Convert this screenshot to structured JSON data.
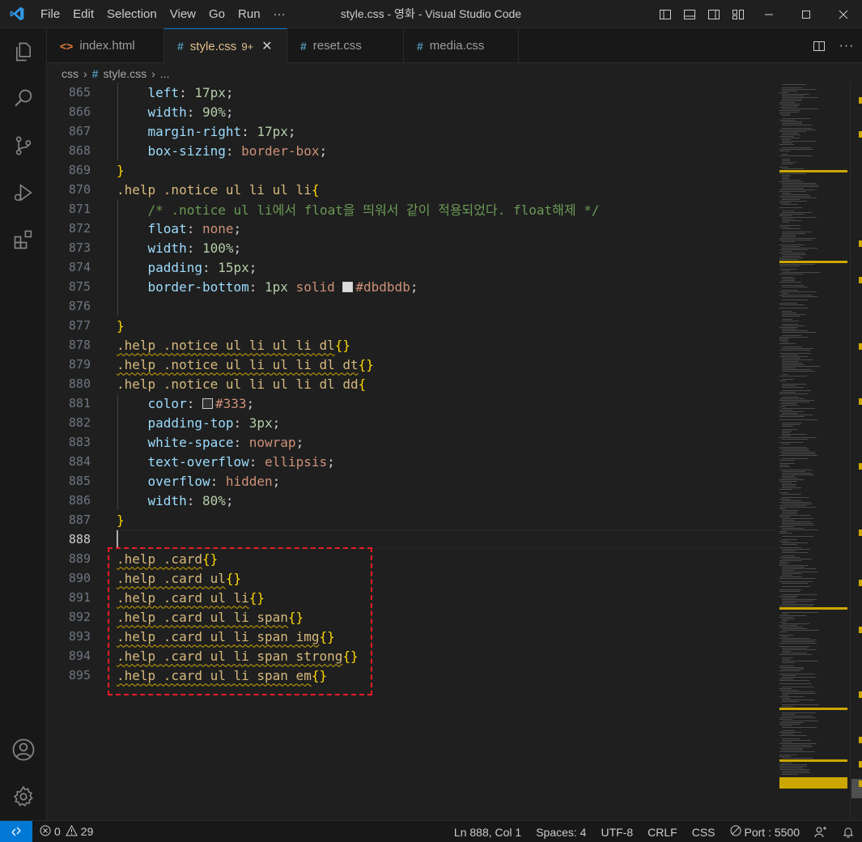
{
  "titlebar": {
    "menu": [
      "File",
      "Edit",
      "Selection",
      "View",
      "Go",
      "Run",
      "···"
    ],
    "title": "style.css - 영화 - Visual Studio Code"
  },
  "tabs": [
    {
      "icon": "<>",
      "label": "index.html",
      "active": false,
      "badge": "",
      "icon_color": "#e37933"
    },
    {
      "icon": "#",
      "label": "style.css",
      "active": true,
      "badge": "9+",
      "icon_color": "#519aba"
    },
    {
      "icon": "#",
      "label": "reset.css",
      "active": false,
      "badge": "",
      "icon_color": "#519aba"
    },
    {
      "icon": "#",
      "label": "media.css",
      "active": false,
      "badge": "",
      "icon_color": "#519aba"
    }
  ],
  "breadcrumb": {
    "folder": "css",
    "file": "style.css",
    "more": "..."
  },
  "editor": {
    "current_line": 888,
    "lines": [
      {
        "n": 865,
        "tokens": [
          [
            "    ",
            "pun"
          ],
          [
            "left",
            "prop"
          ],
          [
            ": ",
            "pun"
          ],
          [
            "17px",
            "num"
          ],
          [
            ";",
            "pun"
          ]
        ]
      },
      {
        "n": 866,
        "tokens": [
          [
            "    ",
            "pun"
          ],
          [
            "width",
            "prop"
          ],
          [
            ": ",
            "pun"
          ],
          [
            "90%",
            "num"
          ],
          [
            ";",
            "pun"
          ]
        ]
      },
      {
        "n": 867,
        "tokens": [
          [
            "    ",
            "pun"
          ],
          [
            "margin-right",
            "prop"
          ],
          [
            ": ",
            "pun"
          ],
          [
            "17px",
            "num"
          ],
          [
            ";",
            "pun"
          ]
        ]
      },
      {
        "n": 868,
        "tokens": [
          [
            "    ",
            "pun"
          ],
          [
            "box-sizing",
            "prop"
          ],
          [
            ": ",
            "pun"
          ],
          [
            "border-box",
            "val"
          ],
          [
            ";",
            "pun"
          ]
        ]
      },
      {
        "n": 869,
        "tokens": [
          [
            "}",
            "br"
          ]
        ]
      },
      {
        "n": 870,
        "tokens": [
          [
            ".help .notice ul li ul li",
            "sel"
          ],
          [
            "{",
            "br"
          ]
        ]
      },
      {
        "n": 871,
        "tokens": [
          [
            "    ",
            "pun"
          ],
          [
            "/* .notice ul li에서 float을 띄워서 같이 적용되었다. float해제 */",
            "com"
          ]
        ]
      },
      {
        "n": 872,
        "tokens": [
          [
            "    ",
            "pun"
          ],
          [
            "float",
            "prop"
          ],
          [
            ": ",
            "pun"
          ],
          [
            "none",
            "val"
          ],
          [
            ";",
            "pun"
          ]
        ]
      },
      {
        "n": 873,
        "tokens": [
          [
            "    ",
            "pun"
          ],
          [
            "width",
            "prop"
          ],
          [
            ": ",
            "pun"
          ],
          [
            "100%",
            "num"
          ],
          [
            ";",
            "pun"
          ]
        ]
      },
      {
        "n": 874,
        "tokens": [
          [
            "    ",
            "pun"
          ],
          [
            "padding",
            "prop"
          ],
          [
            ": ",
            "pun"
          ],
          [
            "15px",
            "num"
          ],
          [
            ";",
            "pun"
          ]
        ]
      },
      {
        "n": 875,
        "tokens": [
          [
            "    ",
            "pun"
          ],
          [
            "border-bottom",
            "prop"
          ],
          [
            ": ",
            "pun"
          ],
          [
            "1px",
            "num"
          ],
          [
            " ",
            "pun"
          ],
          [
            "solid",
            "val"
          ],
          [
            " ",
            "pun"
          ],
          [
            "#dbdbdb",
            "swatch"
          ],
          [
            "#dbdbdb",
            "val"
          ],
          [
            ";",
            "pun"
          ]
        ]
      },
      {
        "n": 876,
        "tokens": []
      },
      {
        "n": 877,
        "tokens": [
          [
            "}",
            "br"
          ]
        ]
      },
      {
        "n": 878,
        "tokens": [
          [
            ".help .notice ul li ul li dl",
            "sel sq"
          ],
          [
            "{}",
            "br"
          ]
        ]
      },
      {
        "n": 879,
        "tokens": [
          [
            ".help .notice ul li ul li dl dt",
            "sel sq"
          ],
          [
            "{}",
            "br"
          ]
        ]
      },
      {
        "n": 880,
        "tokens": [
          [
            ".help .notice ul li ul li dl dd",
            "sel"
          ],
          [
            "{",
            "br"
          ]
        ]
      },
      {
        "n": 881,
        "tokens": [
          [
            "    ",
            "pun"
          ],
          [
            "color",
            "prop"
          ],
          [
            ": ",
            "pun"
          ],
          [
            "#333",
            "swatch"
          ],
          [
            "#333",
            "val"
          ],
          [
            ";",
            "pun"
          ]
        ]
      },
      {
        "n": 882,
        "tokens": [
          [
            "    ",
            "pun"
          ],
          [
            "padding-top",
            "prop"
          ],
          [
            ": ",
            "pun"
          ],
          [
            "3px",
            "num"
          ],
          [
            ";",
            "pun"
          ]
        ]
      },
      {
        "n": 883,
        "tokens": [
          [
            "    ",
            "pun"
          ],
          [
            "white-space",
            "prop"
          ],
          [
            ": ",
            "pun"
          ],
          [
            "nowrap",
            "val"
          ],
          [
            ";",
            "pun"
          ]
        ]
      },
      {
        "n": 884,
        "tokens": [
          [
            "    ",
            "pun"
          ],
          [
            "text-overflow",
            "prop"
          ],
          [
            ": ",
            "pun"
          ],
          [
            "ellipsis",
            "val"
          ],
          [
            ";",
            "pun"
          ]
        ]
      },
      {
        "n": 885,
        "tokens": [
          [
            "    ",
            "pun"
          ],
          [
            "overflow",
            "prop"
          ],
          [
            ": ",
            "pun"
          ],
          [
            "hidden",
            "val"
          ],
          [
            ";",
            "pun"
          ]
        ]
      },
      {
        "n": 886,
        "tokens": [
          [
            "    ",
            "pun"
          ],
          [
            "width",
            "prop"
          ],
          [
            ": ",
            "pun"
          ],
          [
            "80%",
            "num"
          ],
          [
            ";",
            "pun"
          ]
        ]
      },
      {
        "n": 887,
        "tokens": [
          [
            "}",
            "br"
          ]
        ]
      },
      {
        "n": 888,
        "tokens": []
      },
      {
        "n": 889,
        "tokens": [
          [
            ".help .card",
            "sel sq"
          ],
          [
            "{}",
            "br"
          ]
        ]
      },
      {
        "n": 890,
        "tokens": [
          [
            ".help .card ul",
            "sel sq"
          ],
          [
            "{}",
            "br"
          ]
        ]
      },
      {
        "n": 891,
        "tokens": [
          [
            ".help .card ul li",
            "sel sq"
          ],
          [
            "{}",
            "br"
          ]
        ]
      },
      {
        "n": 892,
        "tokens": [
          [
            ".help .card ul li span",
            "sel sq"
          ],
          [
            "{}",
            "br"
          ]
        ]
      },
      {
        "n": 893,
        "tokens": [
          [
            ".help .card ul li span img",
            "sel sq"
          ],
          [
            "{}",
            "br"
          ]
        ]
      },
      {
        "n": 894,
        "tokens": [
          [
            ".help .card ul li span strong",
            "sel sq"
          ],
          [
            "{}",
            "br"
          ]
        ]
      },
      {
        "n": 895,
        "tokens": [
          [
            ".help .card ul li span em",
            "sel sq"
          ],
          [
            "{}",
            "br"
          ]
        ]
      }
    ]
  },
  "statusbar": {
    "errors": "0",
    "warnings": "29",
    "position": "Ln 888, Col 1",
    "spaces": "Spaces: 4",
    "encoding": "UTF-8",
    "eol": "CRLF",
    "language": "CSS",
    "port": "Port : 5500"
  },
  "colors": {
    "accent": "#0078d4",
    "annotation_box": "#e51c23",
    "warning": "#cca700"
  }
}
